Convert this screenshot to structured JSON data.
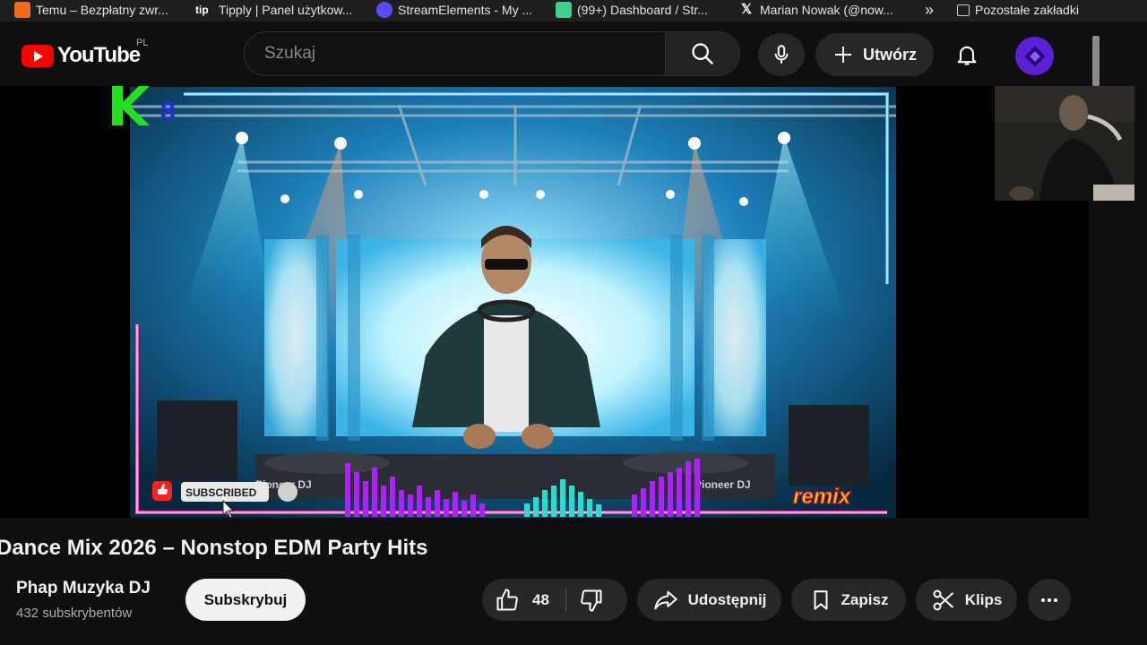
{
  "bookmarks": [
    {
      "label": "Temu – Bezpłatny zwr...",
      "icon": "temu-icon",
      "color": "#f06a1d"
    },
    {
      "label": "Tipply | Panel użytkow...",
      "icon": "tipply-icon",
      "color": "#1f1f1f"
    },
    {
      "label": "StreamElements - My ...",
      "icon": "streamelements-icon",
      "color": "#5b4bff"
    },
    {
      "label": "(99+) Dashboard / Str...",
      "icon": "kick-icon",
      "color": "#3fd08d"
    },
    {
      "label": "Marian Nowak (@now...",
      "icon": "x-icon",
      "color": "#1f1f1f"
    },
    {
      "label": "»",
      "icon": "more-bookmarks-icon"
    },
    {
      "label": "Pozostałe zakładki",
      "icon": "folder-icon"
    }
  ],
  "header": {
    "logo_text": "YouTube",
    "country_code": "PL",
    "search_placeholder": "Szukaj",
    "create_label": "Utwórz"
  },
  "video": {
    "overlay_logo": "K8",
    "subscribed_badge": "SUBSCRIBED",
    "remix_badge": "remix",
    "deck_label_left": "Pioneer DJ",
    "deck_label_right": "Pioneer DJ"
  },
  "details": {
    "title": "Dance Mix 2026 – Nonstop EDM Party Hits",
    "channel_name": "Phap Muzyka DJ",
    "subscribers": "432 subskrybentów",
    "subscribe_label": "Subskrybuj",
    "like_count": "48",
    "share_label": "Udostępnij",
    "save_label": "Zapisz",
    "clip_label": "Klips"
  },
  "colors": {
    "youtube_red": "#ff0000",
    "avatar": "#5b21d6",
    "logo_green": "#22e022",
    "equalizer_purple": "#b020ff",
    "equalizer_cyan": "#20e0d0"
  }
}
